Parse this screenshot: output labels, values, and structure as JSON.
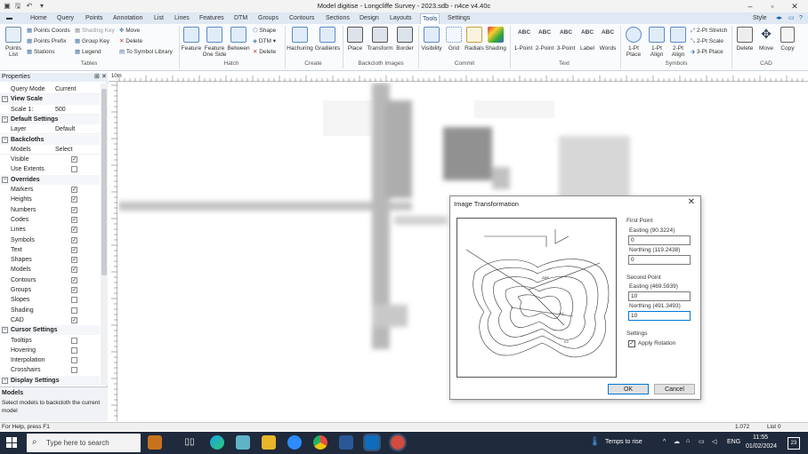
{
  "window": {
    "title": "Model digitise - Longcliffe Survey - 2023.sdb - n4ce v4.40c",
    "quick_access": [
      "save-icon",
      "undo-icon",
      "dropdown-icon"
    ],
    "controls": [
      "minimize-icon",
      "restore-icon",
      "close-icon"
    ]
  },
  "menu": {
    "tabs": [
      "Home",
      "Query",
      "Points",
      "Annotation",
      "List",
      "Lines",
      "Features",
      "DTM",
      "Groups",
      "Contours",
      "Sections",
      "Design",
      "Layouts",
      "Tools",
      "Settings"
    ],
    "active": "Tools",
    "style_label": "Style"
  },
  "ribbon": {
    "groups": {
      "tables": "Tables",
      "hatch": "Hatch",
      "create": "Create",
      "backcloth": "Backcloth Images",
      "commit": "Commit",
      "text": "Text",
      "symbols": "Symbols",
      "cad": "CAD"
    },
    "tables": {
      "points_list": "Points List",
      "points_coords": "Points Coords",
      "points_prefix": "Points Prefix",
      "stations": "Stations",
      "shading_key": "Shading Key",
      "group_key": "Group Key",
      "legend": "Legend",
      "move": "Move",
      "delete": "Delete",
      "to_symbol_library": "To Symbol Library"
    },
    "hatch": {
      "feature": "Feature",
      "feature_one_side": "Feature One Side",
      "between": "Between",
      "shape": "Shape",
      "dtm": "DTM",
      "delete": "Delete"
    },
    "create": {
      "hachuring": "Hachuring",
      "gradients": "Gradients"
    },
    "backcloth": {
      "place": "Place",
      "transform": "Transform",
      "border": "Border"
    },
    "commit": {
      "visibility": "Visibility",
      "grid": "Grid",
      "radials": "Radials",
      "shading": "Shading"
    },
    "text": {
      "one_point": "1-Point",
      "two_point": "2-Point",
      "three_point": "3-Point",
      "label": "Label",
      "words": "Words",
      "abc": "ABC"
    },
    "symbols": {
      "one_pt_place": "1-Pt Place",
      "one_pt_align": "1-Pt Align",
      "two_pt_align": "2-Pt Align",
      "two_pt_stretch": "2-Pt Stretch",
      "two_pt_scale": "2-Pt Scale",
      "three_pt_place": "3-Pt Place"
    },
    "cad": {
      "delete": "Delete",
      "move": "Move",
      "copy": "Copy"
    }
  },
  "properties": {
    "title": "Properties",
    "rows": [
      {
        "type": "field",
        "key": "Query Mode",
        "value": "Current"
      },
      {
        "type": "header",
        "key": "View Scale"
      },
      {
        "type": "field",
        "key": "Scale 1:",
        "value": "500"
      },
      {
        "type": "header",
        "key": "Default Settings"
      },
      {
        "type": "field",
        "key": "Layer",
        "value": "Default"
      },
      {
        "type": "header",
        "key": "Backcloths"
      },
      {
        "type": "field",
        "key": "Models",
        "value": "Select"
      },
      {
        "type": "check",
        "key": "Visible",
        "checked": true
      },
      {
        "type": "check",
        "key": "Use Extents",
        "checked": false
      },
      {
        "type": "header",
        "key": "Overrides"
      },
      {
        "type": "check",
        "key": "Markers",
        "checked": true
      },
      {
        "type": "check",
        "key": "Heights",
        "checked": true
      },
      {
        "type": "check",
        "key": "Numbers",
        "checked": true
      },
      {
        "type": "check",
        "key": "Codes",
        "checked": true
      },
      {
        "type": "check",
        "key": "Lines",
        "checked": true
      },
      {
        "type": "check",
        "key": "Symbols",
        "checked": true
      },
      {
        "type": "check",
        "key": "Text",
        "checked": true
      },
      {
        "type": "check",
        "key": "Shapes",
        "checked": true
      },
      {
        "type": "check",
        "key": "Models",
        "checked": true
      },
      {
        "type": "check",
        "key": "Contours",
        "checked": true
      },
      {
        "type": "check",
        "key": "Groups",
        "checked": true
      },
      {
        "type": "check",
        "key": "Slopes",
        "checked": false
      },
      {
        "type": "check",
        "key": "Shading",
        "checked": false
      },
      {
        "type": "check",
        "key": "CAD",
        "checked": true
      },
      {
        "type": "header",
        "key": "Cursor Settings"
      },
      {
        "type": "check",
        "key": "Tooltips",
        "checked": false
      },
      {
        "type": "check",
        "key": "Hovering",
        "checked": false
      },
      {
        "type": "check",
        "key": "Interpolation",
        "checked": false
      },
      {
        "type": "check",
        "key": "Crosshairs",
        "checked": false
      },
      {
        "type": "header",
        "key": "Display Settings"
      }
    ],
    "help": {
      "title": "Models",
      "text": "Select models to backcloth the current model"
    }
  },
  "canvas": {
    "ruler_label": "10m"
  },
  "dialog": {
    "title": "Image Transformation",
    "first_point": {
      "label": "First Point",
      "easting_label": "Easting (90.3224)",
      "easting_value": "0",
      "northing_label": "Northing (119.2438)",
      "northing_value": "0"
    },
    "second_point": {
      "label": "Second Point",
      "easting_label": "Easting (469.5939)",
      "easting_value": "10",
      "northing_label": "Northing (491.3493)",
      "northing_value": "10"
    },
    "settings": {
      "label": "Settings",
      "apply_rotation_label": "Apply Rotation",
      "apply_rotation": true
    },
    "ok_label": "OK",
    "cancel_label": "Cancel"
  },
  "status": {
    "help_text": "For Help, press F1",
    "coords": "1.072",
    "list": "List 0"
  },
  "taskbar": {
    "search_placeholder": "Type here to search",
    "weather": "Temps to rise",
    "language": "ENG",
    "time": "11:55",
    "date": "01/02/2024",
    "notifications": "23"
  }
}
